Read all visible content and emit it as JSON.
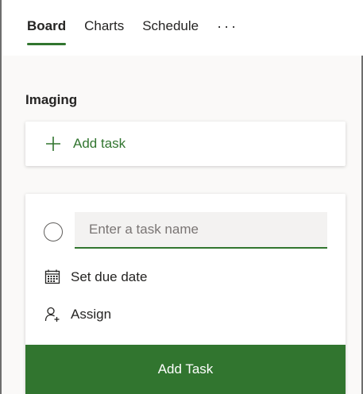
{
  "tabs": [
    {
      "label": "Board",
      "active": true
    },
    {
      "label": "Charts",
      "active": false
    },
    {
      "label": "Schedule",
      "active": false
    }
  ],
  "more_label": "···",
  "bucket": {
    "title": "Imaging"
  },
  "add_task_card": {
    "label": "Add task",
    "icon": "plus-icon"
  },
  "new_task": {
    "name_placeholder": "Enter a task name",
    "name_value": "",
    "due_label": "Set due date",
    "assign_label": "Assign",
    "submit_label": "Add Task"
  },
  "colors": {
    "accent": "#31752f",
    "input_bg": "#f3f2f1",
    "text": "#252423"
  }
}
